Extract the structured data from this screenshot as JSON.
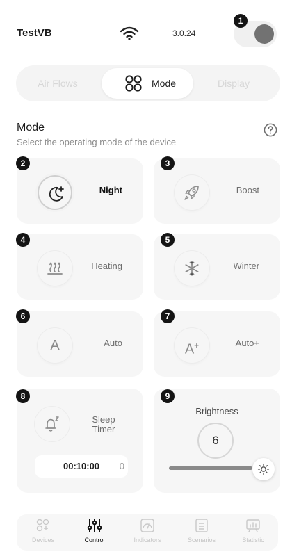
{
  "header": {
    "device_name": "TestVB",
    "version": "3.0.24",
    "wifi_icon": "wifi-icon",
    "power_toggle": "on"
  },
  "markers": [
    "1",
    "2",
    "3",
    "4",
    "5",
    "6",
    "7",
    "8",
    "9"
  ],
  "tabs": [
    {
      "label": "Air Flows",
      "active": false
    },
    {
      "label": "Mode",
      "active": true,
      "icon": "mode-grid-icon"
    },
    {
      "label": "Display",
      "active": false
    }
  ],
  "section": {
    "title": "Mode",
    "subtitle": "Select the operating mode of the device",
    "help_icon": "help-icon"
  },
  "modes": [
    {
      "label": "Night",
      "icon": "night-moon-icon",
      "selected": true
    },
    {
      "label": "Boost",
      "icon": "rocket-icon",
      "selected": false
    },
    {
      "label": "Heating",
      "icon": "heating-icon",
      "selected": false
    },
    {
      "label": "Winter",
      "icon": "snowflake-icon",
      "selected": false
    },
    {
      "label": "Auto",
      "icon": "auto-icon",
      "letter": "A",
      "selected": false
    },
    {
      "label": "Auto+",
      "icon": "auto-plus-icon",
      "letter": "A",
      "selected": false
    }
  ],
  "sleep_timer": {
    "label_line1": "Sleep",
    "label_line2": "Timer",
    "icon": "bell-sleep-icon",
    "time": "00:10:00",
    "trailing": "0"
  },
  "brightness": {
    "title": "Brightness",
    "value": "6",
    "level_fraction": 0.94,
    "icon": "sun-icon"
  },
  "nav": [
    {
      "label": "Devices",
      "icon": "devices-icon",
      "active": false
    },
    {
      "label": "Control",
      "icon": "control-sliders-icon",
      "active": true
    },
    {
      "label": "Indicators",
      "icon": "gauge-icon",
      "active": false
    },
    {
      "label": "Scenarios",
      "icon": "scenarios-icon",
      "active": false
    },
    {
      "label": "Statistic",
      "icon": "statistic-icon",
      "active": false
    }
  ],
  "colors": {
    "background": "#ffffff",
    "card": "#f6f6f6",
    "marker": "#141414",
    "active_text": "#111111",
    "inactive_text": "#c6c6c6"
  }
}
